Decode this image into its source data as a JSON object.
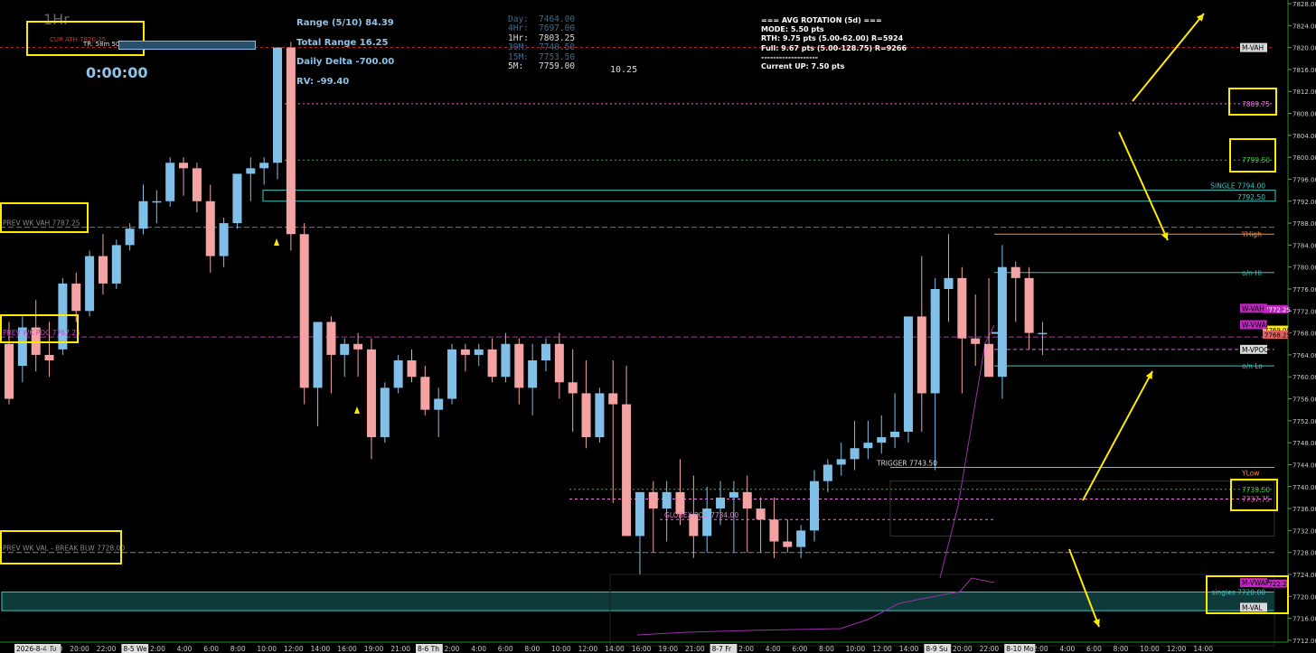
{
  "header": {
    "timeframe": "1Hr",
    "cur_ath": "CUR ATH  7820.25",
    "tr_label": "TR: 58m 50s",
    "timer": "0:00:00"
  },
  "stats": {
    "range": "Range (5/10) 84.39",
    "total_range": "Total Range 16.25",
    "daily_delta": "Daily Delta -700.00",
    "rv": "RV: -99.40"
  },
  "tf_levels": [
    {
      "label": "Day:",
      "value": "7464.00"
    },
    {
      "label": "4Hr:",
      "value": "7697.00"
    },
    {
      "label": "1Hr:",
      "value": "7803.25"
    },
    {
      "label": "30M:",
      "value": "7740.50"
    },
    {
      "label": "15M:",
      "value": "7753.50"
    },
    {
      "label": "5M:",
      "value": "7759.00"
    }
  ],
  "tf_extra": "10.25",
  "rotation": {
    "title": "=== AVG ROTATION (5d) ===",
    "mode": "MODE: 5.50 pts",
    "rth": "RTH:  9.75 pts  (5.00-62.00)  R=5924",
    "full": "Full: 9.67 pts  (5.00-128.75)  R=9266",
    "divider": "-------------------",
    "current": "Current UP: 7.50 pts"
  },
  "chart_labels": {
    "prev_wk_vah": "PREV WK VAH  7787.25",
    "prev_wk_poc": "PREV WK POC  7767.25",
    "prev_wk_val": "PREV WK VAL - BREAK BLW  7728.00",
    "globex_poc": "GLOBEX POC  7734.00",
    "trigger": "TRIGGER  7743.50",
    "single": "SINGLE  7794.00",
    "single_low": "7792.50",
    "singles": "singles  7720.00"
  },
  "right_tags": [
    {
      "text": "M-VAH",
      "price": 7820.0,
      "bg": "#d9d9d9",
      "fg": "#000"
    },
    {
      "text": "7809.75",
      "price": 7809.75,
      "bg": "#000",
      "fg": "#e879d6"
    },
    {
      "text": "7799.50",
      "price": 7799.5,
      "bg": "#000",
      "fg": "#3ad13a"
    },
    {
      "text": "YHigh",
      "price": 7786.0,
      "bg": "#000",
      "fg": "#ff8c3a"
    },
    {
      "text": "o/n Hi",
      "price": 7779.0,
      "bg": "#000",
      "fg": "#38c7c0"
    },
    {
      "text": "W-VAH",
      "price": 7772.5,
      "bg": "#c026c0",
      "fg": "#000"
    },
    {
      "text": "W-VWAP",
      "price": 7769.5,
      "bg": "#c026c0",
      "fg": "#000"
    },
    {
      "text": "M-VPOC",
      "price": 7765.0,
      "bg": "#d9d9d9",
      "fg": "#000"
    },
    {
      "text": "o/n Lo",
      "price": 7762.0,
      "bg": "#000",
      "fg": "#38c7c0"
    },
    {
      "text": "YLow",
      "price": 7742.5,
      "bg": "#000",
      "fg": "#ff8c3a"
    },
    {
      "text": "7739.50",
      "price": 7739.5,
      "bg": "#000",
      "fg": "#3ad13a"
    },
    {
      "text": "7737.75",
      "price": 7737.75,
      "bg": "#000",
      "fg": "#e879d6"
    },
    {
      "text": "M-VWAP",
      "price": 7722.5,
      "bg": "#c026c0",
      "fg": "#000"
    },
    {
      "text": "M-VAL",
      "price": 7718.0,
      "bg": "#d9d9d9",
      "fg": "#000"
    }
  ],
  "colors": {
    "up": "#7fbfe8",
    "down": "#f3a3a3",
    "vwap": "#9b2fa8",
    "highlight": "#ffeb00",
    "cyan": "#38c7c0"
  },
  "chart_data": {
    "type": "candlestick",
    "ylim": [
      7711,
      7828
    ],
    "yticks": [
      7712,
      7716,
      7720,
      7724,
      7728,
      7732,
      7736,
      7740,
      7744,
      7748,
      7752,
      7756,
      7760,
      7764,
      7768,
      7772,
      7776,
      7780,
      7784,
      7788,
      7792,
      7796,
      7800,
      7804,
      7808,
      7812,
      7816,
      7820,
      7824,
      7828
    ],
    "price_tags": [
      {
        "text": "7772.25",
        "price": 7772.25,
        "bg": "#c026c0",
        "fg": "#fff"
      },
      {
        "text": "7769.00",
        "price": 7768.5,
        "bg": "#ffeb00",
        "fg": "#000"
      },
      {
        "text": "7768.25",
        "price": 7767.6,
        "bg": "#e06060",
        "fg": "#000"
      },
      {
        "text": "7722.25",
        "price": 7722.25,
        "bg": "#c026c0",
        "fg": "#000"
      }
    ],
    "xticks": [
      "2026-8-4 Tu",
      "18:00",
      "20:00",
      "22:00",
      "8-5 We",
      "2:00",
      "4:00",
      "6:00",
      "8:00",
      "10:00",
      "12:00",
      "14:00",
      "16:00",
      "19:00",
      "21:00",
      "8-6 Th",
      "2:00",
      "4:00",
      "6:00",
      "8:00",
      "10:00",
      "12:00",
      "14:00",
      "16:00",
      "19:00",
      "21:00",
      "8-7 Fr",
      "2:00",
      "4:00",
      "6:00",
      "8:00",
      "10:00",
      "12:00",
      "14:00",
      "8-9 Su",
      "20:00",
      "22:00",
      "8-10 Mo",
      "2:00",
      "4:00",
      "6:00",
      "8:00",
      "10:00",
      "12:00",
      "14:00"
    ],
    "candles": [
      [
        7766,
        7770,
        7755,
        7756
      ],
      [
        7762,
        7771,
        7759,
        7769
      ],
      [
        7769,
        7774,
        7761,
        7764
      ],
      [
        7764,
        7770,
        7760,
        7763
      ],
      [
        7765,
        7778,
        7764,
        7777
      ],
      [
        7777,
        7779,
        7770,
        7772
      ],
      [
        7772,
        7783,
        7771,
        7782
      ],
      [
        7782,
        7786,
        7775,
        7777
      ],
      [
        7777,
        7785,
        7776,
        7784
      ],
      [
        7784,
        7788,
        7783,
        7787
      ],
      [
        7787,
        7795,
        7786,
        7792
      ],
      [
        7792,
        7794,
        7788,
        7792
      ],
      [
        7792,
        7800,
        7791,
        7799
      ],
      [
        7799,
        7800,
        7793,
        7798
      ],
      [
        7798,
        7799,
        7790,
        7792
      ],
      [
        7792,
        7795,
        7779,
        7782
      ],
      [
        7782,
        7789,
        7780,
        7788
      ],
      [
        7788,
        7795,
        7787,
        7797
      ],
      [
        7797,
        7800,
        7792,
        7798
      ],
      [
        7798,
        7800,
        7795,
        7799
      ],
      [
        7799,
        7816,
        7796,
        7820
      ],
      [
        7820,
        7821,
        7783,
        7786
      ],
      [
        7786,
        7788,
        7755,
        7758
      ],
      [
        7758,
        7770,
        7751,
        7770
      ],
      [
        7770,
        7771,
        7757,
        7764
      ],
      [
        7764,
        7767,
        7760,
        7766
      ],
      [
        7766,
        7768,
        7760,
        7765
      ],
      [
        7765,
        7767,
        7745,
        7749
      ],
      [
        7749,
        7759,
        7748,
        7758
      ],
      [
        7758,
        7764,
        7757,
        7763
      ],
      [
        7763,
        7765,
        7759,
        7760
      ],
      [
        7760,
        7762,
        7753,
        7754
      ],
      [
        7754,
        7758,
        7749,
        7756
      ],
      [
        7756,
        7766,
        7755,
        7765
      ],
      [
        7765,
        7766,
        7761,
        7764
      ],
      [
        7764,
        7766,
        7762,
        7765
      ],
      [
        7765,
        7767,
        7759,
        7760
      ],
      [
        7760,
        7768,
        7759,
        7766
      ],
      [
        7766,
        7767,
        7755,
        7758
      ],
      [
        7758,
        7766,
        7753,
        7763
      ],
      [
        7763,
        7767,
        7761,
        7766
      ],
      [
        7766,
        7768,
        7756,
        7759
      ],
      [
        7759,
        7765,
        7750,
        7757
      ],
      [
        7757,
        7763,
        7747,
        7749
      ],
      [
        7749,
        7758,
        7748,
        7757
      ],
      [
        7757,
        7763,
        7737,
        7755
      ],
      [
        7755,
        7762,
        7742,
        7731
      ],
      [
        7731,
        7739,
        7724,
        7739
      ],
      [
        7739,
        7741,
        7728,
        7736
      ],
      [
        7736,
        7741,
        7730,
        7739
      ],
      [
        7739,
        7745,
        7733,
        7735
      ],
      [
        7735,
        7742,
        7727,
        7731
      ],
      [
        7731,
        7740,
        7728,
        7736
      ],
      [
        7736,
        7741,
        7733,
        7738
      ],
      [
        7738,
        7741,
        7728,
        7739
      ],
      [
        7739,
        7742,
        7728,
        7736
      ],
      [
        7736,
        7738,
        7728,
        7734
      ],
      [
        7734,
        7738,
        7727,
        7730
      ],
      [
        7730,
        7734,
        7728,
        7729
      ],
      [
        7729,
        7733,
        7727,
        7732
      ],
      [
        7732,
        7743,
        7730,
        7741
      ],
      [
        7741,
        7745,
        7739,
        7744
      ],
      [
        7744,
        7748,
        7742,
        7745
      ],
      [
        7745,
        7752,
        7743,
        7747
      ],
      [
        7747,
        7752,
        7745,
        7748
      ],
      [
        7748,
        7753,
        7746,
        7749
      ],
      [
        7749,
        7757,
        7747,
        7750
      ],
      [
        7750,
        7760,
        7748,
        7771
      ],
      [
        7771,
        7782,
        7750,
        7757
      ],
      [
        7757,
        7778,
        7743,
        7776
      ],
      [
        7776,
        7786,
        7770,
        7778
      ],
      [
        7778,
        7780,
        7757,
        7767
      ],
      [
        7767,
        7775,
        7762,
        7766
      ],
      [
        7766,
        7778,
        7760,
        7760
      ],
      [
        7760,
        7784,
        7756,
        7780
      ],
      [
        7780,
        7781,
        7770,
        7778
      ],
      [
        7778,
        7780,
        7765,
        7768
      ],
      [
        7768,
        7770,
        7764,
        7768
      ]
    ]
  }
}
